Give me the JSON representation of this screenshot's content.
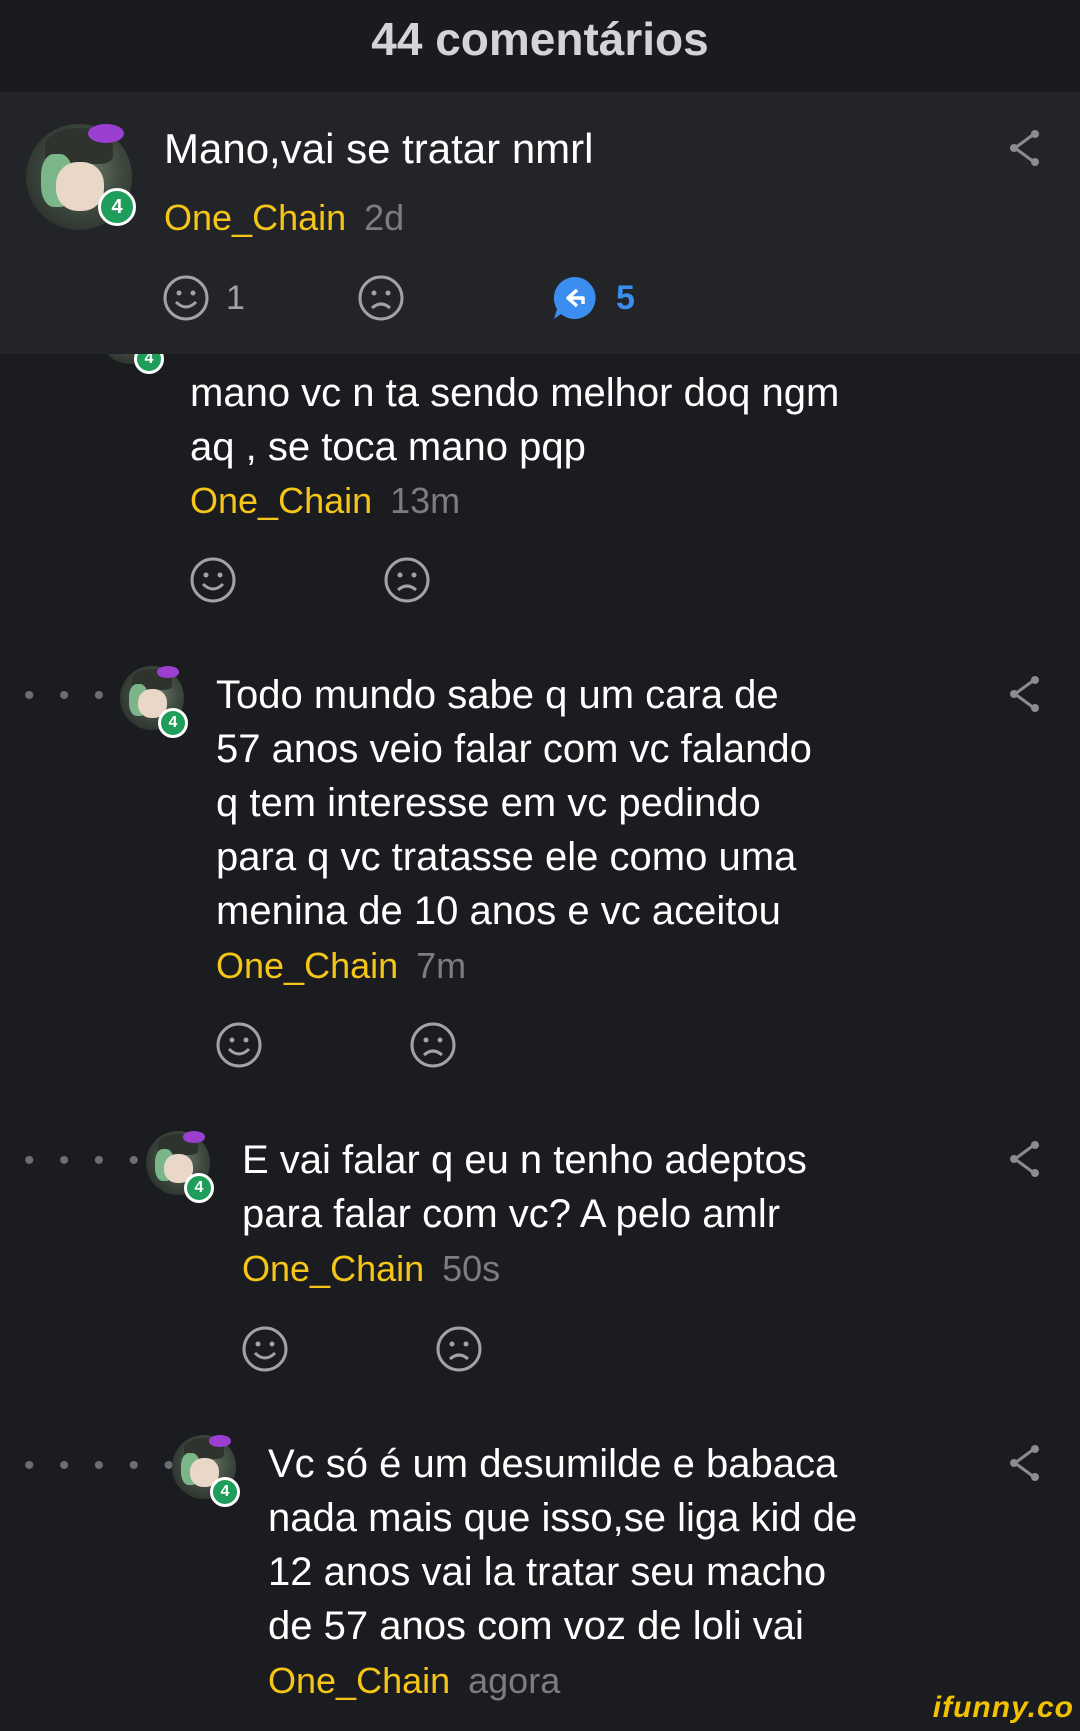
{
  "header": {
    "title": "44 comentários"
  },
  "top_comment": {
    "text": "Mano,vai se tratar nmrl",
    "username": "One_Chain",
    "time": "2d",
    "level": "4",
    "smile_count": "1",
    "reply_count": "5"
  },
  "replies": [
    {
      "text_lines": [
        "mano vc n ta sendo melhor doq ngm",
        "aq , se toca mano pqp"
      ],
      "username": "One_Chain",
      "time": "13m",
      "level": "4"
    },
    {
      "text_lines": [
        "Todo mundo sabe q um cara de",
        "57 anos veio falar com vc falando",
        "q tem interesse em vc pedindo",
        "para q vc tratasse ele como uma",
        "menina de 10 anos e vc aceitou"
      ],
      "username": "One_Chain",
      "time": "7m",
      "level": "4",
      "dots": "• • •"
    },
    {
      "text_lines": [
        "E vai falar q eu n tenho adeptos",
        "para falar com vc? A pelo amlr"
      ],
      "username": "One_Chain",
      "time": "50s",
      "level": "4",
      "dots": "• • • •"
    },
    {
      "text_lines": [
        "Vc só é um desumilde e babaca",
        "nada mais que isso,se liga kid de",
        "12 anos vai la tratar seu macho",
        "de 57 anos com voz de loli vai"
      ],
      "username": "One_Chain",
      "time": "agora",
      "level": "4",
      "dots": "• • • • •"
    }
  ],
  "icons": {
    "share": "share-icon",
    "smile": "smile-icon",
    "frown": "frown-icon",
    "reply": "reply-bubble-icon"
  },
  "colors": {
    "background": "#1b1c20",
    "top_comment_bg": "#232428",
    "username": "#f5c518",
    "reply_accent": "#3b8ef0",
    "level_badge": "#1f9d5a"
  },
  "watermark": "ifunny.co"
}
